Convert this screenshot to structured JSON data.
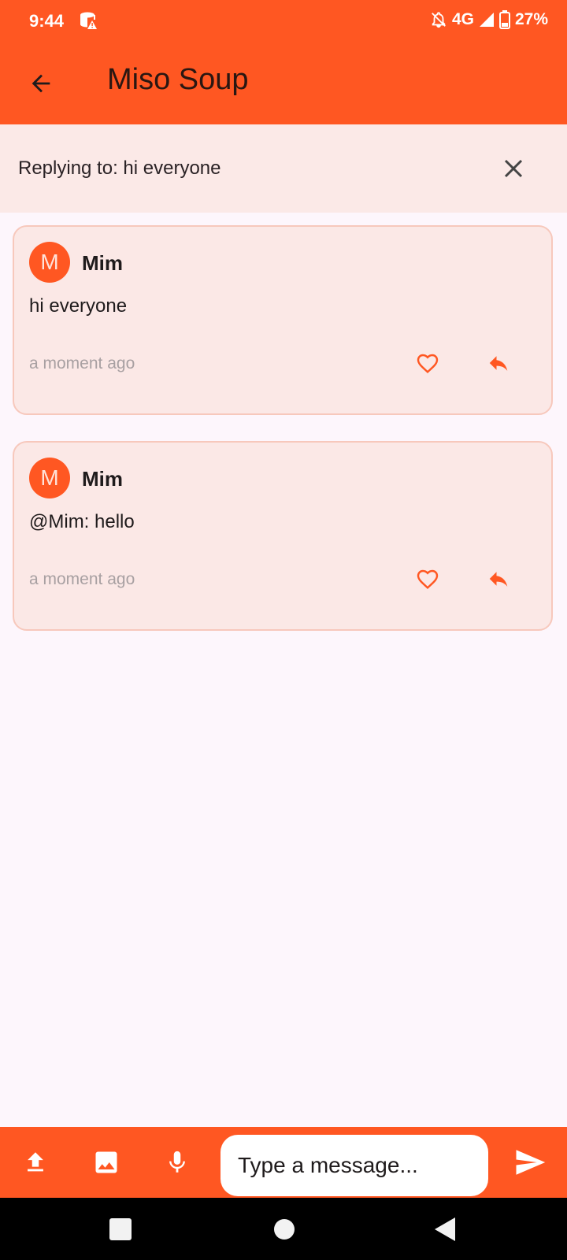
{
  "status_bar": {
    "time": "9:44",
    "network": "4G",
    "battery": "27%",
    "icons": [
      "database-warning-icon",
      "bell-off-icon",
      "signal-icon",
      "battery-icon"
    ]
  },
  "app_bar": {
    "title": "Miso Soup",
    "back_icon": "arrow-back-icon"
  },
  "reply_banner": {
    "text": "Replying to: hi everyone",
    "close_icon": "close-icon"
  },
  "comments": [
    {
      "avatar_letter": "M",
      "author": "Mim",
      "body": "hi everyone",
      "time": "a moment ago",
      "like_icon": "heart-outline-icon",
      "reply_icon": "reply-icon"
    },
    {
      "avatar_letter": "M",
      "author": "Mim",
      "body": "@Mim: hello",
      "time": "a moment ago",
      "like_icon": "heart-outline-icon",
      "reply_icon": "reply-icon"
    }
  ],
  "composer": {
    "placeholder": "Type a message...",
    "icons": [
      "upload-icon",
      "image-icon",
      "mic-icon",
      "send-icon"
    ]
  },
  "nav_bar": {
    "icons": [
      "recents-square-icon",
      "home-circle-icon",
      "back-triangle-icon"
    ]
  },
  "colors": {
    "primary": "#ff5722",
    "banner_bg": "#fbe9e7",
    "card_bg": "#fbe8e6",
    "card_border": "#f7c8bc",
    "page_bg": "#fdf6fc",
    "muted_text": "#a8a0a2"
  }
}
